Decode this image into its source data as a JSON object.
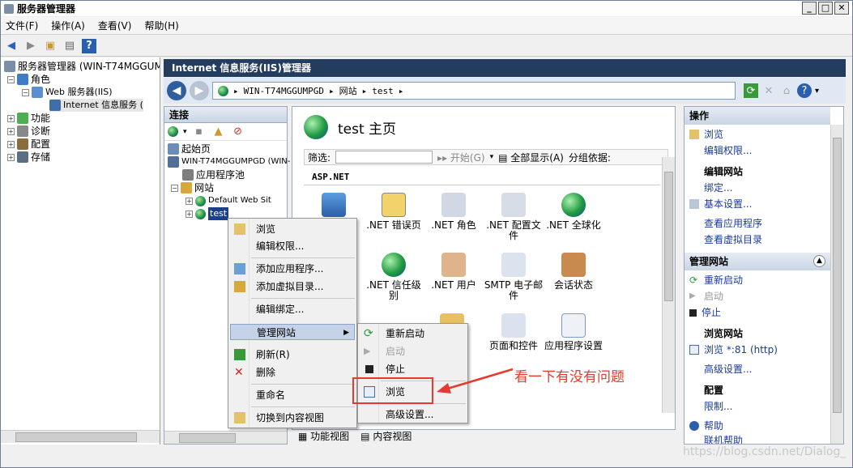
{
  "window": {
    "title": "服务器管理器",
    "buttons": [
      "_",
      "□",
      "✕"
    ]
  },
  "menubar": [
    "文件(F)",
    "操作(A)",
    "查看(V)",
    "帮助(H)"
  ],
  "left_tree": {
    "items": [
      {
        "label": "服务器管理器 (WIN-T74MGGUMPG",
        "pm": ""
      },
      {
        "label": "角色",
        "pm": "−"
      },
      {
        "label": "Web 服务器(IIS)",
        "pm": "−"
      },
      {
        "label": "Internet 信息服务 (",
        "pm": ""
      },
      {
        "label": "功能",
        "pm": "+"
      },
      {
        "label": "诊断",
        "pm": "+"
      },
      {
        "label": "配置",
        "pm": "+"
      },
      {
        "label": "存储",
        "pm": "+"
      }
    ]
  },
  "iis": {
    "header": "Internet 信息服务(IIS)管理器",
    "breadcrumb": [
      "WIN-T74MGGUMPGD",
      "网站",
      "test"
    ],
    "connections": {
      "title": "连接",
      "tree": [
        {
          "label": "起始页",
          "pm": ""
        },
        {
          "label": "WIN-T74MGGUMPGD (WIN-",
          "pm": "−"
        },
        {
          "label": "应用程序池",
          "pm": ""
        },
        {
          "label": "网站",
          "pm": "−"
        },
        {
          "label": "Default Web Sit",
          "pm": "+"
        },
        {
          "label": "test",
          "pm": "+"
        }
      ]
    },
    "main": {
      "title": "test 主页",
      "filter_label": "筛选:",
      "filter_go": "开始(G)",
      "filter_showall": "全部显示(A)",
      "filter_group": "分组依据:",
      "section": "ASP.NET",
      "tiles": [
        ".NET 错误页",
        ".NET 角色",
        ".NET 配置文件",
        ".NET 全球化",
        ".NET 信任级别",
        ".NET 用户",
        "SMTP 电子邮件",
        "会话状态",
        "务",
        "页面和控件",
        "应用程序设置"
      ]
    },
    "view_tabs": [
      "功能视图",
      "内容视图"
    ],
    "actions": {
      "title": "操作",
      "group1": [
        "浏览",
        "编辑权限..."
      ],
      "edit_site_title": "编辑网站",
      "group2": [
        "绑定...",
        "基本设置..."
      ],
      "group3": [
        "查看应用程序",
        "查看虚拟目录"
      ],
      "manage_title": "管理网站",
      "manage": [
        "重新启动",
        "启动",
        "停止"
      ],
      "browse_title": "浏览网站",
      "browse_link": "浏览 *:81 (http)",
      "advanced": "高级设置...",
      "config_title": "配置",
      "limit": "限制...",
      "help": "帮助",
      "online_help": "联机帮助"
    }
  },
  "context_menu": {
    "items": [
      "浏览",
      "编辑权限...",
      "添加应用程序...",
      "添加虚拟目录...",
      "编辑绑定...",
      "管理网站",
      "刷新(R)",
      "删除",
      "重命名",
      "切换到内容视图"
    ]
  },
  "submenu": {
    "items": [
      "重新启动",
      "启动",
      "停止",
      "浏览",
      "高级设置..."
    ]
  },
  "annotation": "看一下有没有问题",
  "watermark": "https://blog.csdn.net/Dialog_",
  "colors": {
    "annotation": "#e63a2e",
    "header": "#243c5e",
    "link": "#1a3a9a"
  }
}
